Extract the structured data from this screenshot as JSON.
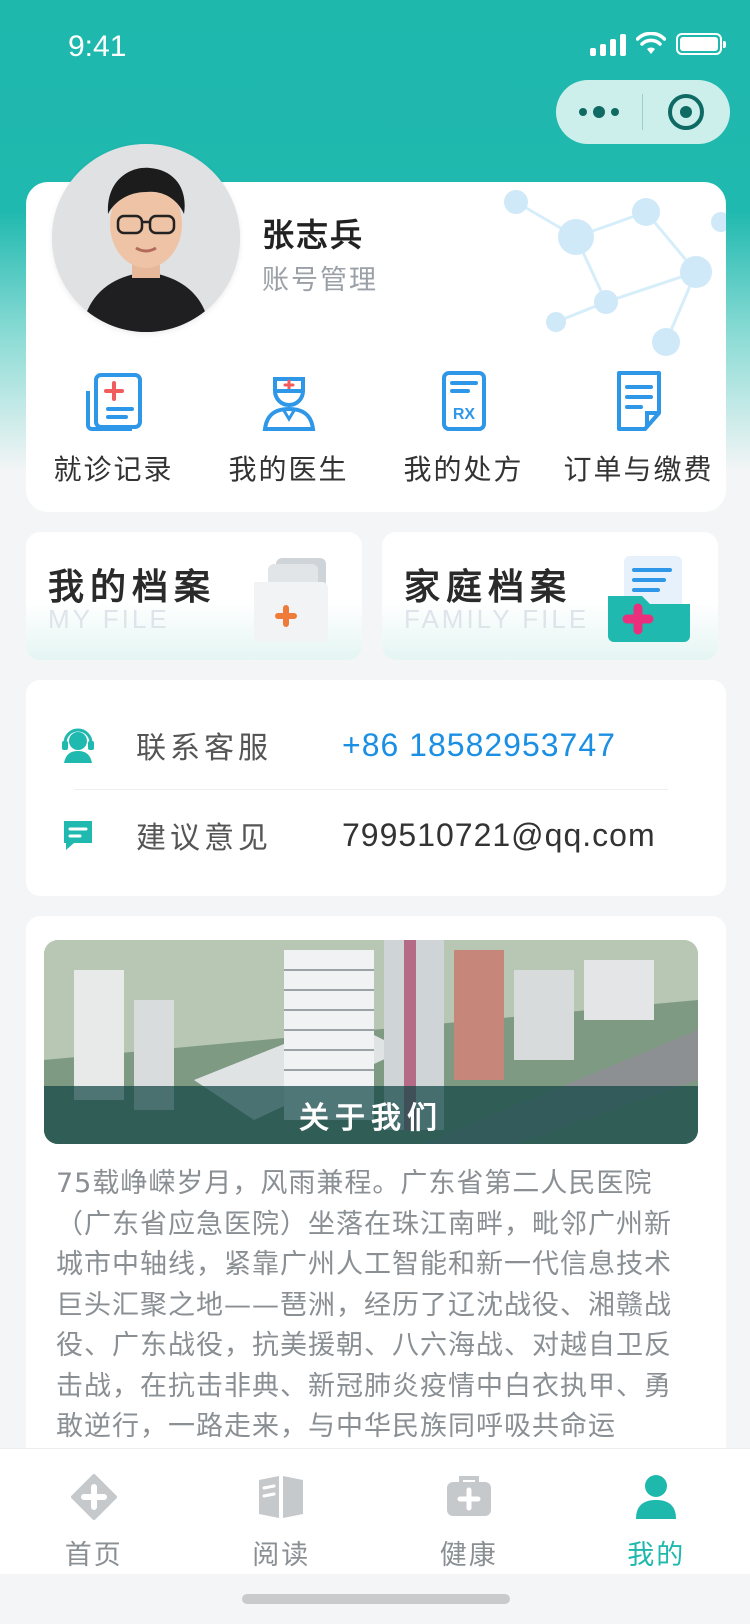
{
  "status_bar": {
    "time": "9:41"
  },
  "user": {
    "name": "张志兵",
    "account_link": "账号管理"
  },
  "quick_actions": [
    {
      "label": "就诊记录",
      "icon": "medical-record-icon"
    },
    {
      "label": "我的医生",
      "icon": "doctor-icon"
    },
    {
      "label": "我的处方",
      "icon": "prescription-icon"
    },
    {
      "label": "订单与缴费",
      "icon": "order-icon"
    }
  ],
  "files": {
    "my": {
      "title": "我的档案",
      "subtitle": "MY FILE"
    },
    "family": {
      "title": "家庭档案",
      "subtitle": "FAMILY FILE"
    }
  },
  "contact": {
    "service_label": "联系客服",
    "service_value": "+86 18582953747",
    "feedback_label": "建议意见",
    "feedback_value": "799510721@qq.com"
  },
  "about": {
    "title": "关于我们",
    "text": "75载峥嵘岁月，风雨兼程。广东省第二人民医院（广东省应急医院）坐落在珠江南畔，毗邻广州新城市中轴线，紧靠广州人工智能和新一代信息技术巨头汇聚之地——琶洲，经历了辽沈战役、湘赣战役、广东战役，抗美援朝、八六海战、对越自卫反击战，在抗击非典、新冠肺炎疫情中白衣执甲、勇敢逆行，一路走来，与中华民族同呼吸共命运"
  },
  "tabs": [
    {
      "label": "首页",
      "icon": "home-icon",
      "active": false
    },
    {
      "label": "阅读",
      "icon": "book-icon",
      "active": false
    },
    {
      "label": "健康",
      "icon": "health-kit-icon",
      "active": false
    },
    {
      "label": "我的",
      "icon": "user-icon",
      "active": true
    }
  ],
  "colors": {
    "brand": "#1fb8ad",
    "link_blue": "#1a8fe3",
    "icon_blue": "#2f97e8"
  }
}
